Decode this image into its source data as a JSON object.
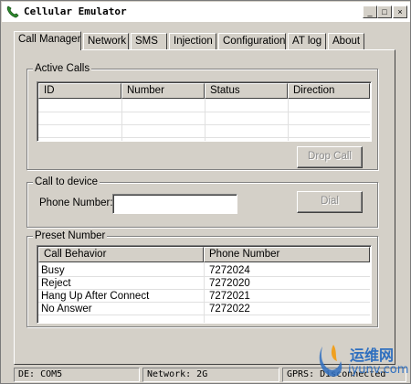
{
  "window": {
    "title": "Cellular Emulator",
    "minimize_label": "_",
    "maximize_label": "□",
    "close_label": "×"
  },
  "tabs": [
    {
      "label": "Call Manager",
      "active": true
    },
    {
      "label": "Network"
    },
    {
      "label": "SMS"
    },
    {
      "label": "Injection"
    },
    {
      "label": "Configuration"
    },
    {
      "label": "AT log"
    },
    {
      "label": "About"
    }
  ],
  "active_calls": {
    "title": "Active Calls",
    "columns": [
      "ID",
      "Number",
      "Status",
      "Direction"
    ],
    "rows": [],
    "drop_call_label": "Drop Call"
  },
  "call_to_device": {
    "title": "Call to device",
    "phone_label": "Phone Number:",
    "phone_value": "",
    "dial_label": "Dial"
  },
  "preset_number": {
    "title": "Preset Number",
    "columns": [
      "Call Behavior",
      "Phone Number"
    ],
    "rows": [
      [
        "Busy",
        "7272024"
      ],
      [
        "Reject",
        "7272020"
      ],
      [
        "Hang Up After Connect",
        "7272021"
      ],
      [
        "No Answer",
        "7272022"
      ]
    ]
  },
  "status_bar": {
    "de": "DE: COM5",
    "network": "Network: 2G",
    "gprs": "GPRS: Disconnected"
  },
  "watermark": {
    "line1": "运维网",
    "line2": "iyunv.com"
  },
  "colors": {
    "face": "#d4d0c8",
    "watermark": "#2f6fbf"
  }
}
